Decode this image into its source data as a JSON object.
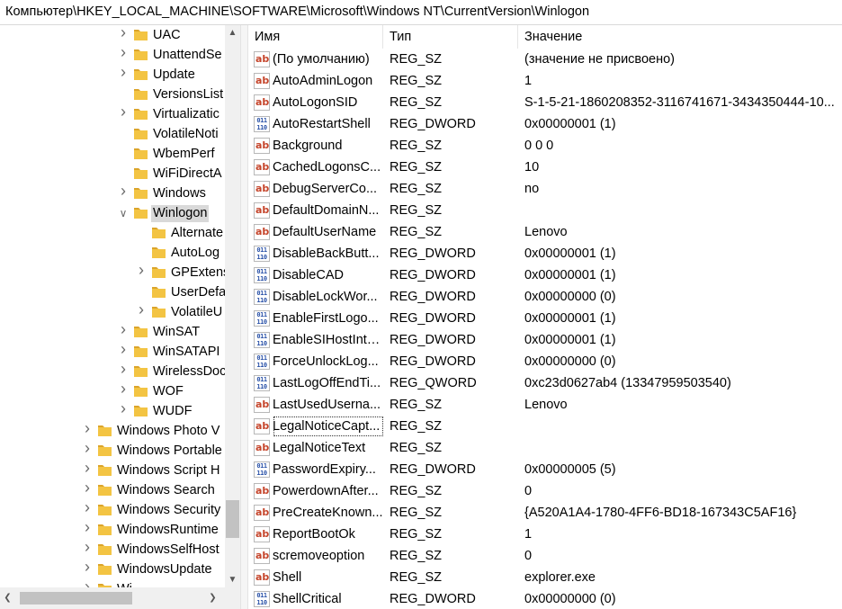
{
  "address_bar": {
    "path": "Компьютер\\HKEY_LOCAL_MACHINE\\SOFTWARE\\Microsoft\\Windows NT\\CurrentVersion\\Winlogon"
  },
  "tree": {
    "items": [
      {
        "label": "UAC",
        "indent": 2,
        "expander": "collapsed",
        "selected": false
      },
      {
        "label": "UnattendSe",
        "indent": 2,
        "expander": "collapsed",
        "selected": false
      },
      {
        "label": "Update",
        "indent": 2,
        "expander": "collapsed",
        "selected": false
      },
      {
        "label": "VersionsList",
        "indent": 2,
        "expander": "none",
        "selected": false
      },
      {
        "label": "Virtualizatic",
        "indent": 2,
        "expander": "collapsed",
        "selected": false
      },
      {
        "label": "VolatileNoti",
        "indent": 2,
        "expander": "none",
        "selected": false
      },
      {
        "label": "WbemPerf",
        "indent": 2,
        "expander": "none",
        "selected": false
      },
      {
        "label": "WiFiDirectA",
        "indent": 2,
        "expander": "none",
        "selected": false
      },
      {
        "label": "Windows",
        "indent": 2,
        "expander": "collapsed",
        "selected": false
      },
      {
        "label": "Winlogon",
        "indent": 2,
        "expander": "expanded",
        "selected": true
      },
      {
        "label": "Alternate",
        "indent": 3,
        "expander": "none",
        "selected": false
      },
      {
        "label": "AutoLog",
        "indent": 3,
        "expander": "none",
        "selected": false
      },
      {
        "label": "GPExtens",
        "indent": 3,
        "expander": "collapsed",
        "selected": false
      },
      {
        "label": "UserDefa",
        "indent": 3,
        "expander": "none",
        "selected": false
      },
      {
        "label": "VolatileU",
        "indent": 3,
        "expander": "collapsed",
        "selected": false
      },
      {
        "label": "WinSAT",
        "indent": 2,
        "expander": "collapsed",
        "selected": false
      },
      {
        "label": "WinSATAPI",
        "indent": 2,
        "expander": "collapsed",
        "selected": false
      },
      {
        "label": "WirelessDoc",
        "indent": 2,
        "expander": "collapsed",
        "selected": false
      },
      {
        "label": "WOF",
        "indent": 2,
        "expander": "collapsed",
        "selected": false
      },
      {
        "label": "WUDF",
        "indent": 2,
        "expander": "collapsed",
        "selected": false
      },
      {
        "label": "Windows Photo V",
        "indent": 0,
        "expander": "collapsed",
        "selected": false
      },
      {
        "label": "Windows Portable",
        "indent": 0,
        "expander": "collapsed",
        "selected": false
      },
      {
        "label": "Windows Script H",
        "indent": 0,
        "expander": "collapsed",
        "selected": false
      },
      {
        "label": "Windows Search",
        "indent": 0,
        "expander": "collapsed",
        "selected": false
      },
      {
        "label": "Windows Security",
        "indent": 0,
        "expander": "collapsed",
        "selected": false
      },
      {
        "label": "WindowsRuntime",
        "indent": 0,
        "expander": "collapsed",
        "selected": false
      },
      {
        "label": "WindowsSelfHost",
        "indent": 0,
        "expander": "collapsed",
        "selected": false
      },
      {
        "label": "WindowsUpdate",
        "indent": 0,
        "expander": "collapsed",
        "selected": false
      },
      {
        "label": "Wi...",
        "indent": 0,
        "expander": "collapsed",
        "selected": false
      }
    ]
  },
  "values": {
    "headers": {
      "name": "Имя",
      "type": "Тип",
      "data": "Значение"
    },
    "rows": [
      {
        "name": "(По умолчанию)",
        "type": "REG_SZ",
        "data": "(значение не присвоено)",
        "icon": "string-value-icon"
      },
      {
        "name": "AutoAdminLogon",
        "type": "REG_SZ",
        "data": "1",
        "icon": "string-value-icon"
      },
      {
        "name": "AutoLogonSID",
        "type": "REG_SZ",
        "data": "S-1-5-21-1860208352-3116741671-3434350444-10...",
        "icon": "string-value-icon"
      },
      {
        "name": "AutoRestartShell",
        "type": "REG_DWORD",
        "data": "0x00000001 (1)",
        "icon": "binary-value-icon"
      },
      {
        "name": "Background",
        "type": "REG_SZ",
        "data": "0 0 0",
        "icon": "string-value-icon"
      },
      {
        "name": "CachedLogonsC...",
        "type": "REG_SZ",
        "data": "10",
        "icon": "string-value-icon"
      },
      {
        "name": "DebugServerCo...",
        "type": "REG_SZ",
        "data": "no",
        "icon": "string-value-icon"
      },
      {
        "name": "DefaultDomainN...",
        "type": "REG_SZ",
        "data": "",
        "icon": "string-value-icon"
      },
      {
        "name": "DefaultUserName",
        "type": "REG_SZ",
        "data": "Lenovo",
        "icon": "string-value-icon"
      },
      {
        "name": "DisableBackButt...",
        "type": "REG_DWORD",
        "data": "0x00000001 (1)",
        "icon": "binary-value-icon"
      },
      {
        "name": "DisableCAD",
        "type": "REG_DWORD",
        "data": "0x00000001 (1)",
        "icon": "binary-value-icon"
      },
      {
        "name": "DisableLockWor...",
        "type": "REG_DWORD",
        "data": "0x00000000 (0)",
        "icon": "binary-value-icon"
      },
      {
        "name": "EnableFirstLogo...",
        "type": "REG_DWORD",
        "data": "0x00000001 (1)",
        "icon": "binary-value-icon"
      },
      {
        "name": "EnableSIHostInte...",
        "type": "REG_DWORD",
        "data": "0x00000001 (1)",
        "icon": "binary-value-icon"
      },
      {
        "name": "ForceUnlockLog...",
        "type": "REG_DWORD",
        "data": "0x00000000 (0)",
        "icon": "binary-value-icon"
      },
      {
        "name": "LastLogOffEndTi...",
        "type": "REG_QWORD",
        "data": "0xc23d0627ab4 (13347959503540)",
        "icon": "binary-value-icon"
      },
      {
        "name": "LastUsedUserna...",
        "type": "REG_SZ",
        "data": "Lenovo",
        "icon": "string-value-icon"
      },
      {
        "name": "LegalNoticeCapt...",
        "type": "REG_SZ",
        "data": "",
        "icon": "string-value-icon"
      },
      {
        "name": "LegalNoticeText",
        "type": "REG_SZ",
        "data": "",
        "icon": "string-value-icon"
      },
      {
        "name": "PasswordExpiry...",
        "type": "REG_DWORD",
        "data": "0x00000005 (5)",
        "icon": "binary-value-icon"
      },
      {
        "name": "PowerdownAfter...",
        "type": "REG_SZ",
        "data": "0",
        "icon": "string-value-icon"
      },
      {
        "name": "PreCreateKnown...",
        "type": "REG_SZ",
        "data": "{A520A1A4-1780-4FF6-BD18-167343C5AF16}",
        "icon": "string-value-icon"
      },
      {
        "name": "ReportBootOk",
        "type": "REG_SZ",
        "data": "1",
        "icon": "string-value-icon"
      },
      {
        "name": "scremoveoption",
        "type": "REG_SZ",
        "data": "0",
        "icon": "string-value-icon"
      },
      {
        "name": "Shell",
        "type": "REG_SZ",
        "data": "explorer.exe",
        "icon": "string-value-icon"
      },
      {
        "name": "ShellCritical",
        "type": "REG_DWORD",
        "data": "0x00000000 (0)",
        "icon": "binary-value-icon"
      }
    ]
  },
  "icons": {
    "string_glyph": "ab",
    "binary_glyph": "011 110",
    "folder_color": "#f3c443",
    "folder_dark": "#dba42a"
  }
}
